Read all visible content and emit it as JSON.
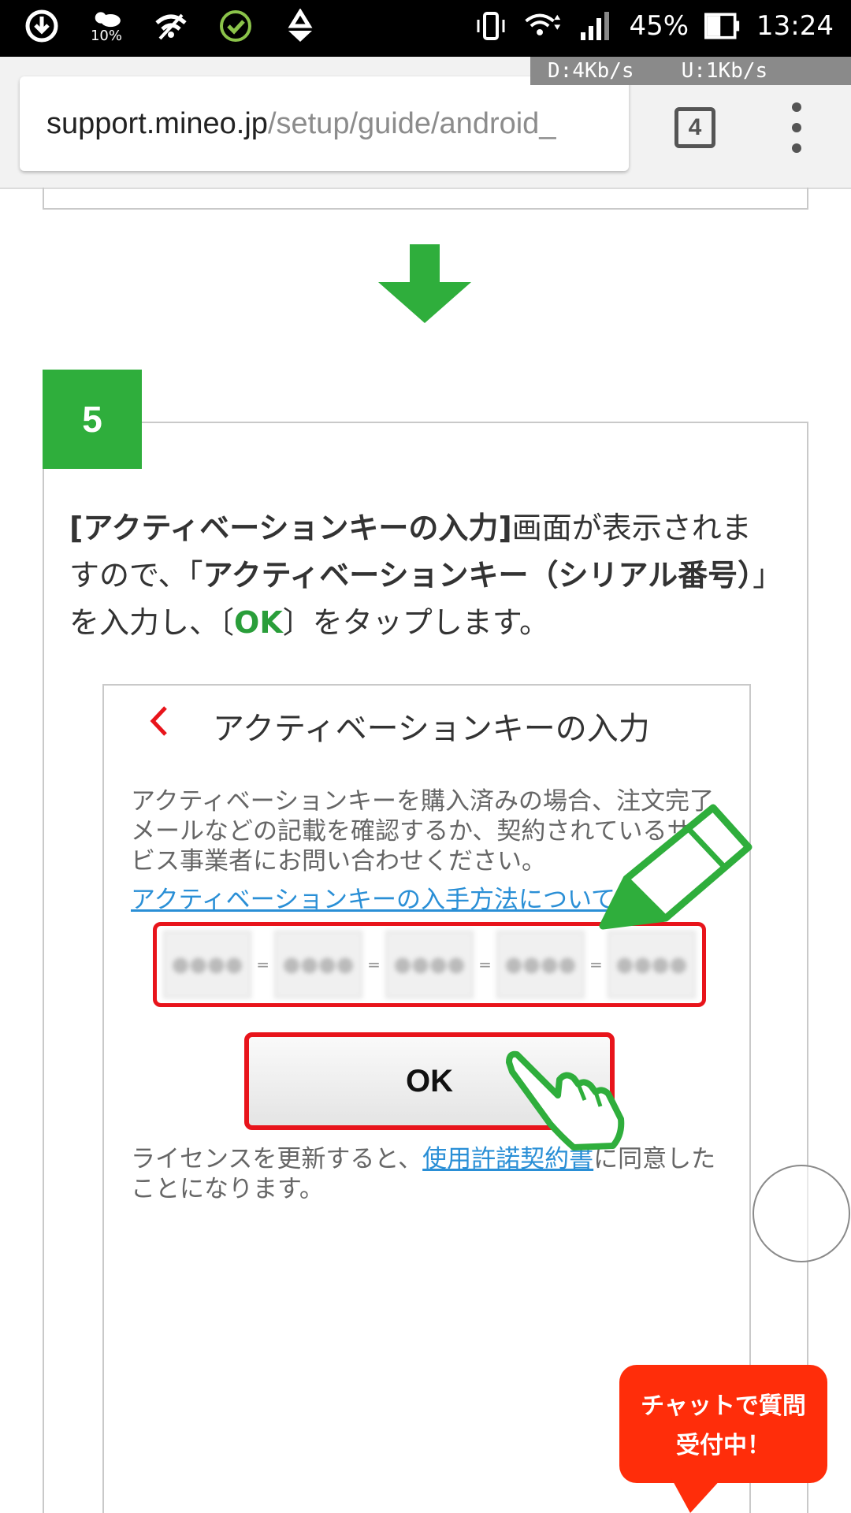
{
  "status_bar": {
    "battery_percent": "45%",
    "time": "13:24",
    "weather_label": "10%",
    "download_speed": "D:4Kb/s",
    "upload_speed": "U:1Kb/s",
    "icons": [
      "download-icon",
      "weather-icon",
      "wifi-eye-icon",
      "check-circle-icon",
      "recycle-icon",
      "vibrate-icon",
      "wifi-icon",
      "signal-icon",
      "battery-icon"
    ]
  },
  "browser": {
    "url_host": "support.mineo.jp",
    "url_path": "/setup/guide/android_",
    "tab_count": "4"
  },
  "step": {
    "number": "5",
    "instruction_part1": "[アクティベーションキーの入力]",
    "instruction_part2": "画面が表示されますので、「",
    "instruction_part3": "アクティベーションキー（シリアル番号）",
    "instruction_part4": "」を入力し、〔",
    "instruction_ok": "OK",
    "instruction_part5": "〕をタップします。"
  },
  "screenshot": {
    "title": "アクティベーションキーの入力",
    "description": "アクティベーションキーを購入済みの場合、注文完了メールなどの記載を確認するか、契約されているサービス事業者にお問い合わせください。",
    "link": "アクティベーションキーの入手方法について",
    "key_segments": [
      "●●●●",
      "●●●●",
      "●●●●",
      "●●●●",
      "●●●●"
    ],
    "ok_button": "OK",
    "license_prefix": "ライセンスを更新すると、",
    "license_link": "使用許諾契約書",
    "license_suffix": "に同意したことになります。"
  },
  "chat": {
    "line1": "チャットで質問",
    "line2": "受付中！"
  },
  "colors": {
    "accent_green": "#2fae3c",
    "highlight_red": "#e8141b",
    "chat_red": "#ff2d0a",
    "link_blue": "#2a8fd6"
  }
}
